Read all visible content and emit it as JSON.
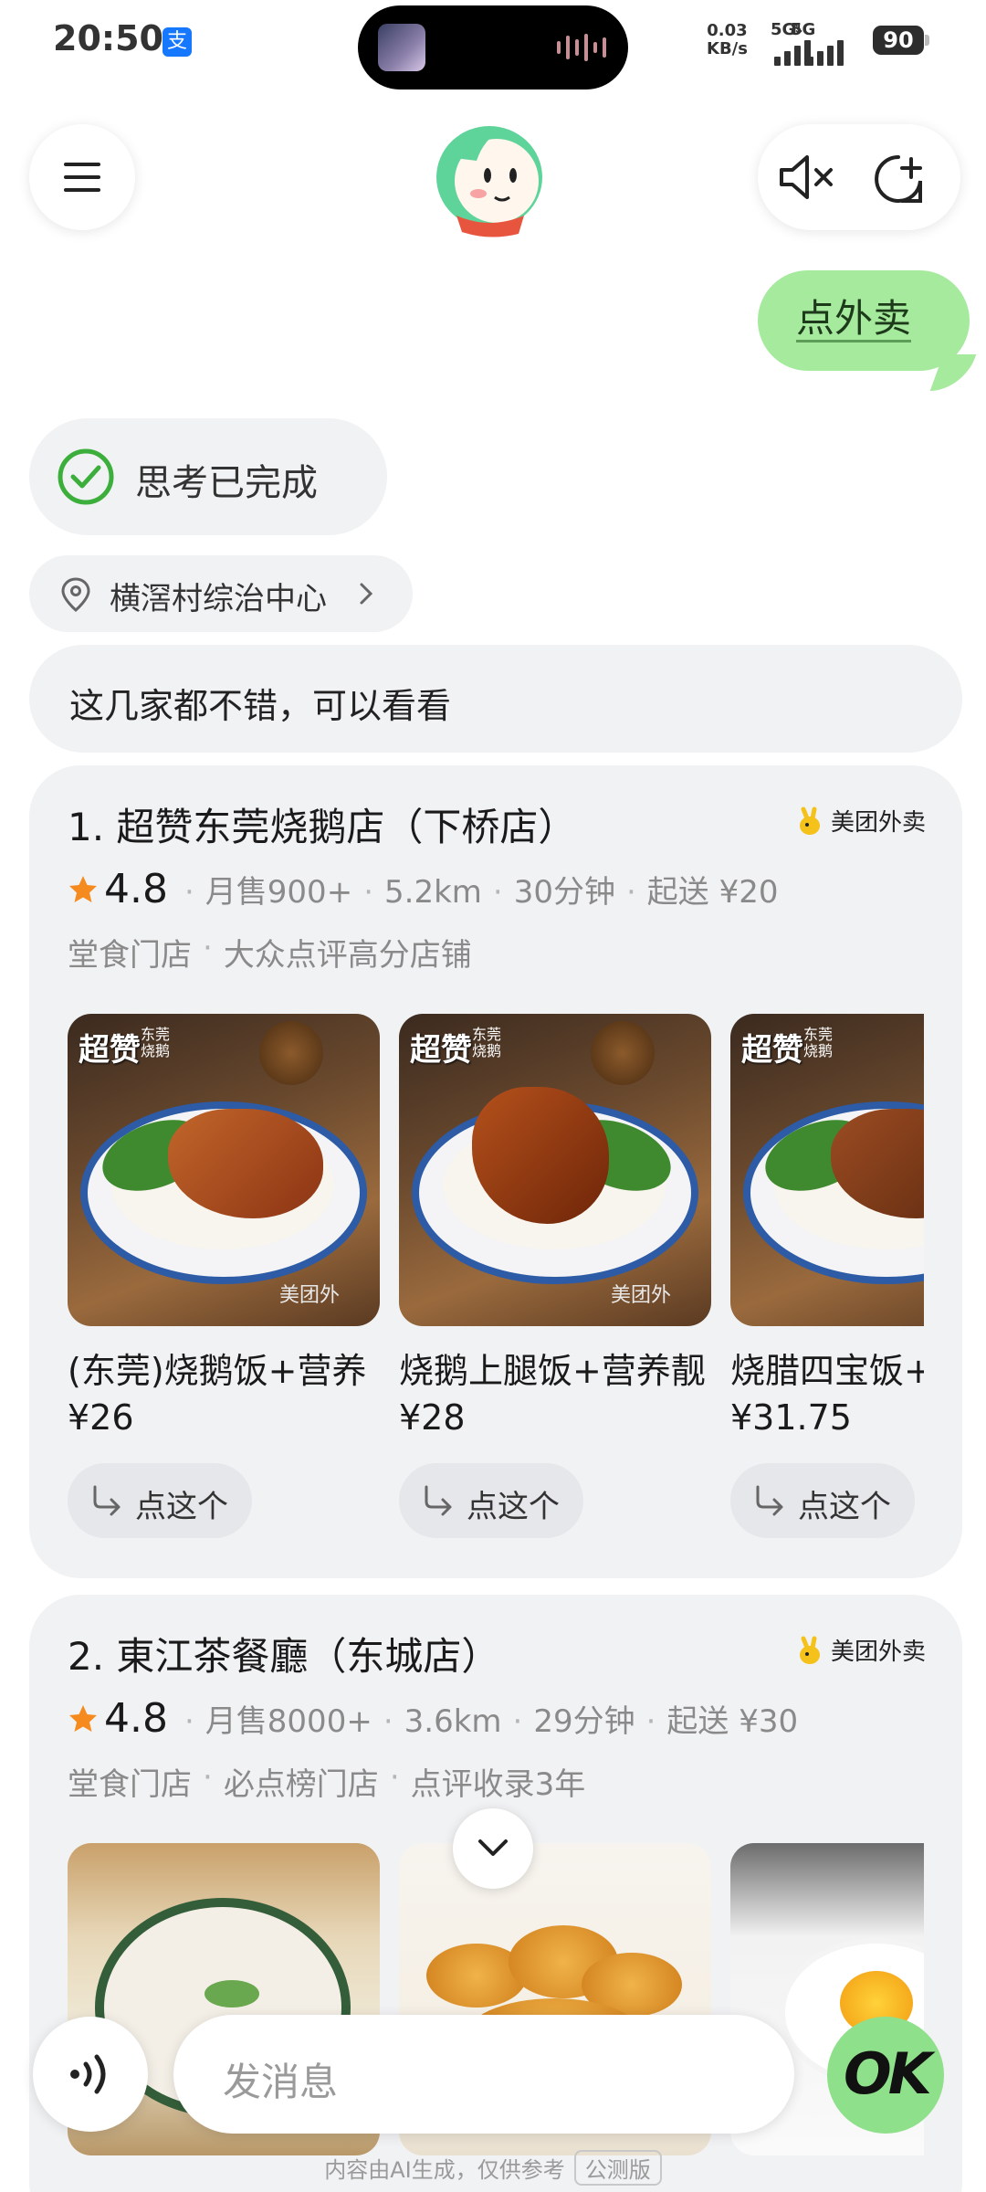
{
  "status_bar": {
    "time": "20:50",
    "net_speed_value": "0.03",
    "net_speed_unit": "KB/s",
    "sim1": "5G",
    "sim2": "5G",
    "battery": "90"
  },
  "header": {
    "menu_icon": "hamburger-menu-icon",
    "mute_icon": "speaker-muted-icon",
    "new_chat_icon": "new-chat-icon"
  },
  "conversation": {
    "user_message": "点外卖",
    "thinking_status": "思考已完成",
    "location": "横滘村综治中心",
    "reply": "这几家都不错，可以看看"
  },
  "stores": [
    {
      "name": "1. 超赞东莞烧鹅店（下桥店）",
      "platform": "美团外卖",
      "rating": "4.8",
      "monthly_sales": "月售900+",
      "distance": "5.2km",
      "delivery_time": "30分钟",
      "min_order": "起送 ¥20",
      "tags": [
        "堂食门店",
        "大众点评高分店铺"
      ],
      "dishes": [
        {
          "name": "(东莞)烧鹅饭+营养",
          "price": "¥26",
          "order_label": "点这个",
          "img_logo": "超赞",
          "img_sub": "东莞\n烧鹅",
          "img_wm": "美团外"
        },
        {
          "name": "烧鹅上腿饭+营养靓",
          "price": "¥28",
          "order_label": "点这个",
          "img_logo": "超赞",
          "img_sub": "东莞\n烧鹅",
          "img_wm": "美团外"
        },
        {
          "name": "烧腊四宝饭+",
          "price": "¥31.75",
          "order_label": "点这个",
          "img_logo": "超赞",
          "img_sub": "东莞\n烧鹅",
          "img_wm": ""
        }
      ]
    },
    {
      "name": "2. 東江茶餐廳（东城店）",
      "platform": "美团外卖",
      "rating": "4.8",
      "monthly_sales": "月售8000+",
      "distance": "3.6km",
      "delivery_time": "29分钟",
      "min_order": "起送 ¥30",
      "tags": [
        "堂食门店",
        "必点榜门店",
        "点评收录3年"
      ]
    }
  ],
  "composer": {
    "placeholder": "发消息",
    "ok_label": "OK"
  },
  "footer": {
    "disclaimer": "内容由AI生成，仅供参考",
    "badge": "公测版"
  },
  "colors": {
    "user_bubble": "#a6ea9e",
    "card_bg": "#f1f2f4",
    "check_green": "#3cae3c",
    "star_orange": "#f58a1f"
  }
}
